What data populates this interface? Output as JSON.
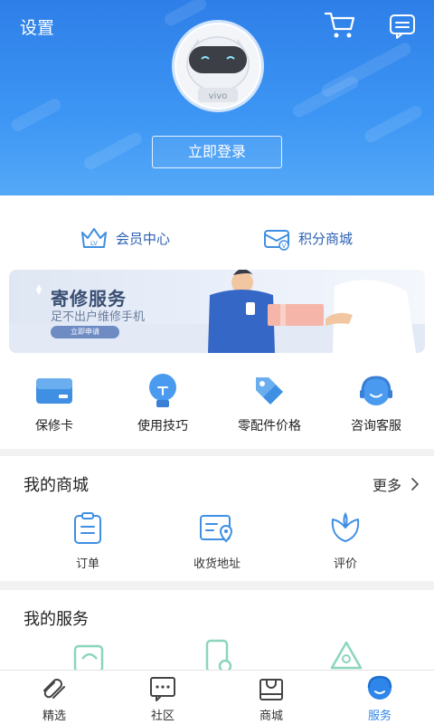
{
  "header": {
    "settings_label": "设置",
    "login_label": "立即登录",
    "avatar_text": "vivo"
  },
  "member": {
    "vip_label": "会员中心",
    "points_label": "积分商城"
  },
  "banner": {
    "title": "寄修服务",
    "subtitle": "足不出户维修手机",
    "button": "立即申请"
  },
  "quick_actions": [
    {
      "label": "保修卡",
      "icon": "warranty-card-icon"
    },
    {
      "label": "使用技巧",
      "icon": "lightbulb-icon"
    },
    {
      "label": "零配件价格",
      "icon": "price-tag-icon"
    },
    {
      "label": "咨询客服",
      "icon": "customer-service-icon"
    }
  ],
  "my_mall": {
    "title": "我的商城",
    "more_label": "更多",
    "items": [
      {
        "label": "订单",
        "icon": "order-icon"
      },
      {
        "label": "收货地址",
        "icon": "address-icon"
      },
      {
        "label": "评价",
        "icon": "review-icon"
      }
    ]
  },
  "my_service": {
    "title": "我的服务"
  },
  "tabbar": [
    {
      "label": "精选",
      "icon": "featured-icon",
      "active": false
    },
    {
      "label": "社区",
      "icon": "community-icon",
      "active": false
    },
    {
      "label": "商城",
      "icon": "mall-icon",
      "active": false
    },
    {
      "label": "服务",
      "icon": "service-icon",
      "active": true
    }
  ],
  "colors": {
    "brand_blue": "#2f86ea",
    "header_top": "#2e7fe8",
    "icon_blue": "#3f8fe3"
  }
}
